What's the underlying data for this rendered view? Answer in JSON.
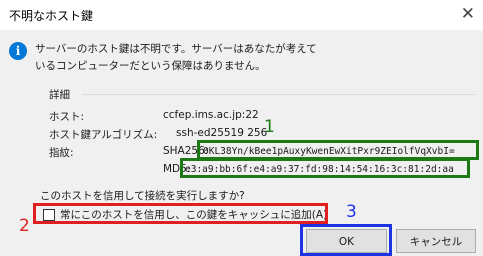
{
  "dialog": {
    "title": "不明なホスト鍵",
    "close_glyph": "✕",
    "info_glyph": "i",
    "message_line1": "サーバーのホスト鍵は不明です。サーバーはあなたが考えて",
    "message_line2": "いるコンピューターだという保障はありません。",
    "details_title": "詳細",
    "host_label": "ホスト:",
    "host_value": "ccfep.ims.ac.jp:22",
    "algo_label": "ホスト鍵アルゴリズム:",
    "algo_value": "ssh-ed25519 256",
    "fingerprint_label": "指紋:",
    "sha256_prefix": "SHA256:",
    "sha256_value": "0KL38Yn/kBee1pAuxyKwenEwXitPxr9ZEIolfVqXvbI=",
    "md5_prefix": "MD5:",
    "md5_value": "e3:a9:bb:6f:e4:a9:37:fd:98:14:54:16:3c:81:2d:aa",
    "question": "このホストを信用して接続を実行しますか?",
    "checkbox_label": "常にこのホストを信用し、この鍵をキャッシュに追加(A)",
    "ok_label": "OK",
    "cancel_label": "キャンセル"
  },
  "annotations": {
    "label_1": "1",
    "label_2": "2",
    "label_3": "3"
  },
  "colors": {
    "annotation_green": "#1b7a14",
    "annotation_red": "#e02020",
    "annotation_blue": "#1e32e6",
    "info_icon": "#0078d7"
  }
}
